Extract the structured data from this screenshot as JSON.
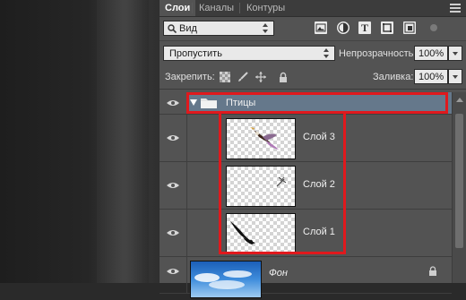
{
  "tabs": [
    "Слои",
    "Каналы",
    "Контуры"
  ],
  "filter": {
    "kind_value": "Вид",
    "kind_icon": "search-icon",
    "filter_icons": [
      "image-icon",
      "adjustment-icon",
      "text-icon",
      "shape-icon",
      "smart-object-icon"
    ]
  },
  "blend": {
    "mode_value": "Пропустить",
    "opacity_label": "Непрозрачность:",
    "opacity_value": "100%"
  },
  "lock": {
    "label": "Закрепить:",
    "fill_label": "Заливка:",
    "fill_value": "100%",
    "lock_icons": [
      "lock-transparency-icon",
      "lock-brush-icon",
      "lock-move-icon",
      "lock-all-icon"
    ]
  },
  "layers": [
    {
      "name": "Птицы",
      "type": "group",
      "expanded": true
    },
    {
      "name": "Слой 3",
      "type": "layer"
    },
    {
      "name": "Слой 2",
      "type": "layer"
    },
    {
      "name": "Слой 1",
      "type": "layer"
    },
    {
      "name": "Фон",
      "type": "background",
      "locked": true
    }
  ],
  "colors": {
    "highlight": "#e0191d",
    "panel": "#535353",
    "group_selected": "#65788b"
  }
}
